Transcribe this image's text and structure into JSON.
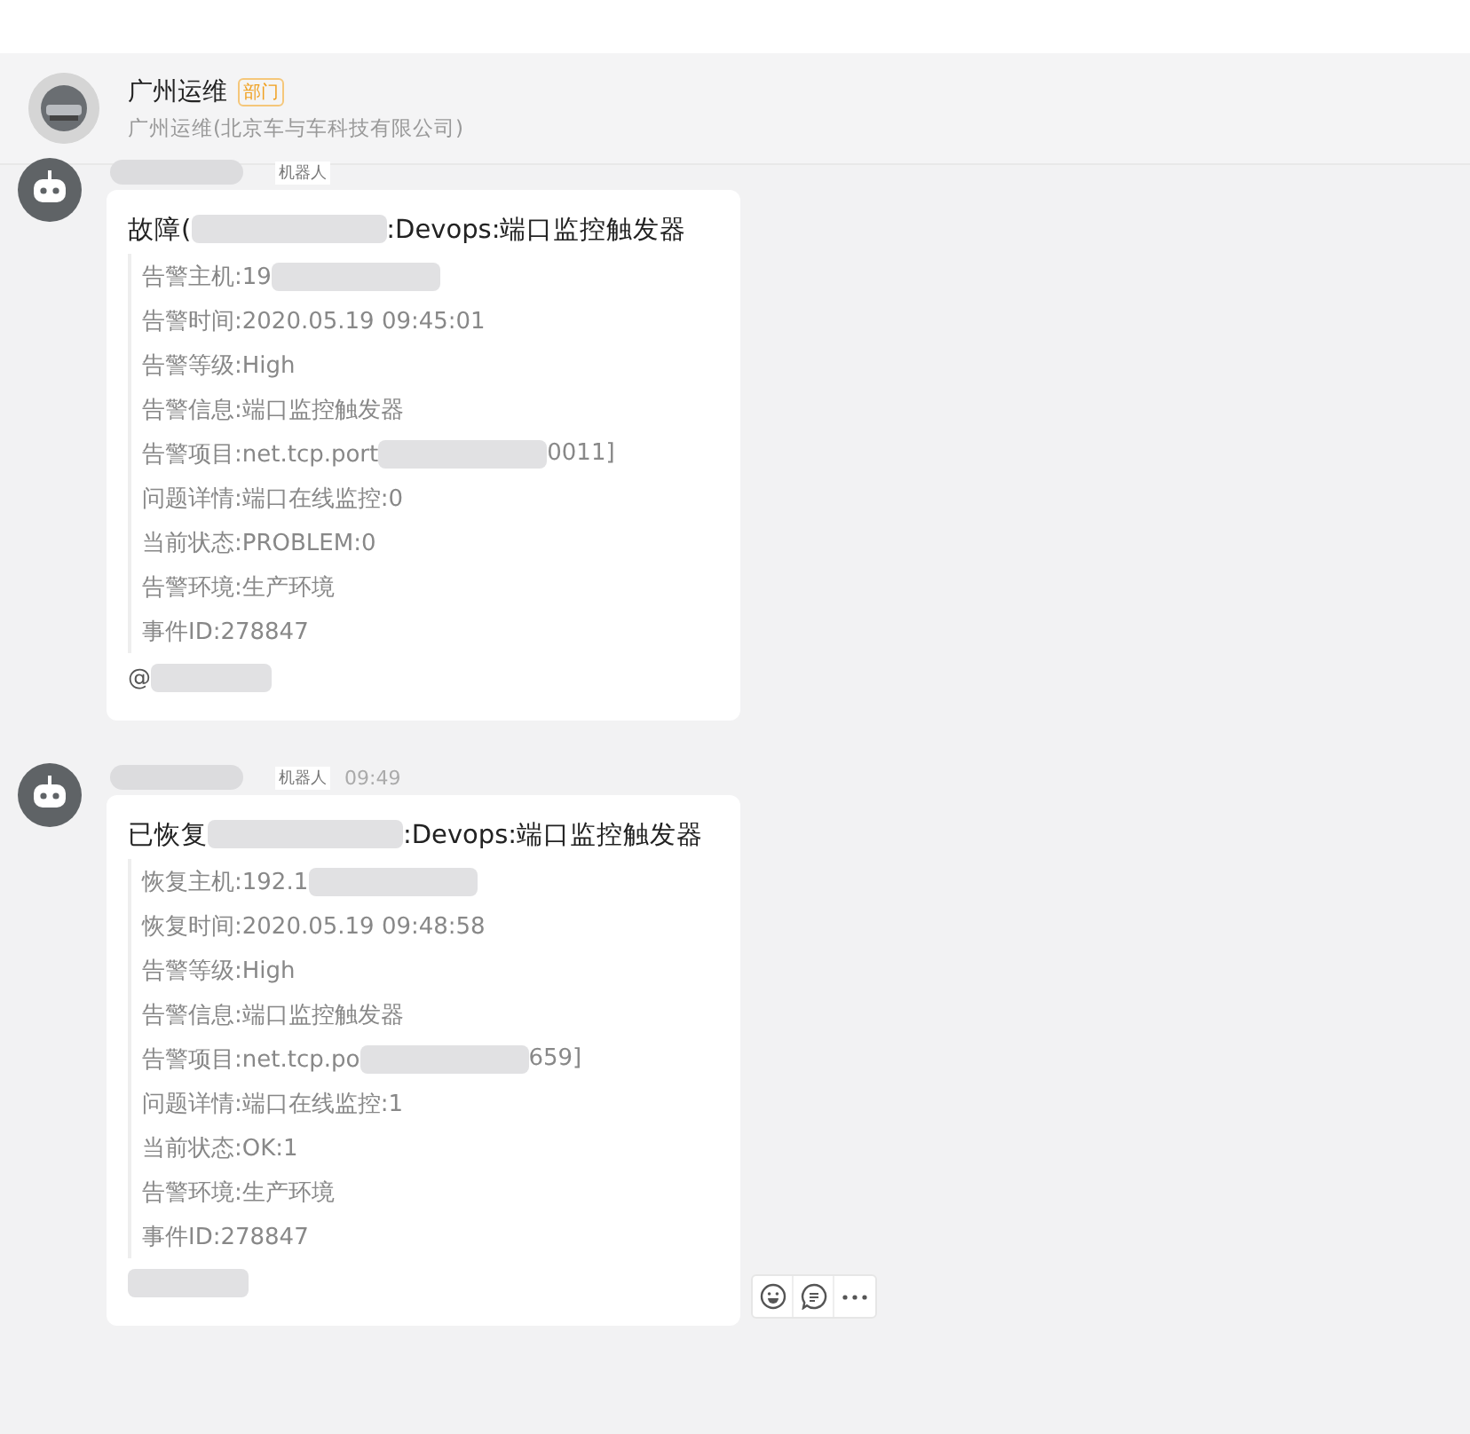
{
  "header": {
    "name": "广州运维",
    "tag": "部门",
    "subtitle": "广州运维(北京车与车科技有限公司)"
  },
  "messages": [
    {
      "sender_tag": "机器人",
      "show_actions": false,
      "title": [
        {
          "kind": "text",
          "text": "故障("
        },
        {
          "kind": "redacted"
        },
        {
          "kind": "text",
          "text": ":Devops:端口监控触发器"
        }
      ],
      "lines": [
        [
          {
            "kind": "text",
            "text": "告警主机:19"
          },
          {
            "kind": "redacted"
          }
        ],
        [
          {
            "kind": "text",
            "text": "告警时间:2020.05.19 09:45:01"
          }
        ],
        [
          {
            "kind": "text",
            "text": "告警等级:High"
          }
        ],
        [
          {
            "kind": "text",
            "text": "告警信息:端口监控触发器"
          }
        ],
        [
          {
            "kind": "text",
            "text": "告警项目:net.tcp.port"
          },
          {
            "kind": "redacted"
          },
          {
            "kind": "text",
            "text": "0011]"
          }
        ],
        [
          {
            "kind": "text",
            "text": "问题详情:端口在线监控:0"
          }
        ],
        [
          {
            "kind": "text",
            "text": "当前状态:PROBLEM:0"
          }
        ],
        [
          {
            "kind": "text",
            "text": "告警环境:生产环境"
          }
        ],
        [
          {
            "kind": "text",
            "text": "事件ID:278847"
          }
        ]
      ],
      "mention": [
        {
          "kind": "text",
          "text": "@"
        },
        {
          "kind": "redacted"
        }
      ]
    },
    {
      "sender_tag": "机器人",
      "time": "09:49",
      "show_actions": true,
      "title": [
        {
          "kind": "text",
          "text": "已恢复"
        },
        {
          "kind": "redacted"
        },
        {
          "kind": "text",
          "text": ":Devops:端口监控触发器"
        }
      ],
      "lines": [
        [
          {
            "kind": "text",
            "text": "恢复主机:192.1"
          },
          {
            "kind": "redacted"
          }
        ],
        [
          {
            "kind": "text",
            "text": "恢复时间:2020.05.19 09:48:58"
          }
        ],
        [
          {
            "kind": "text",
            "text": "告警等级:High"
          }
        ],
        [
          {
            "kind": "text",
            "text": "告警信息:端口监控触发器"
          }
        ],
        [
          {
            "kind": "text",
            "text": "告警项目:net.tcp.po"
          },
          {
            "kind": "redacted"
          },
          {
            "kind": "text",
            "text": "659]"
          }
        ],
        [
          {
            "kind": "text",
            "text": "问题详情:端口在线监控:1"
          }
        ],
        [
          {
            "kind": "text",
            "text": "当前状态:OK:1"
          }
        ],
        [
          {
            "kind": "text",
            "text": "告警环境:生产环境"
          }
        ],
        [
          {
            "kind": "text",
            "text": "事件ID:278847"
          }
        ]
      ],
      "mention": [
        {
          "kind": "redacted"
        }
      ]
    }
  ]
}
